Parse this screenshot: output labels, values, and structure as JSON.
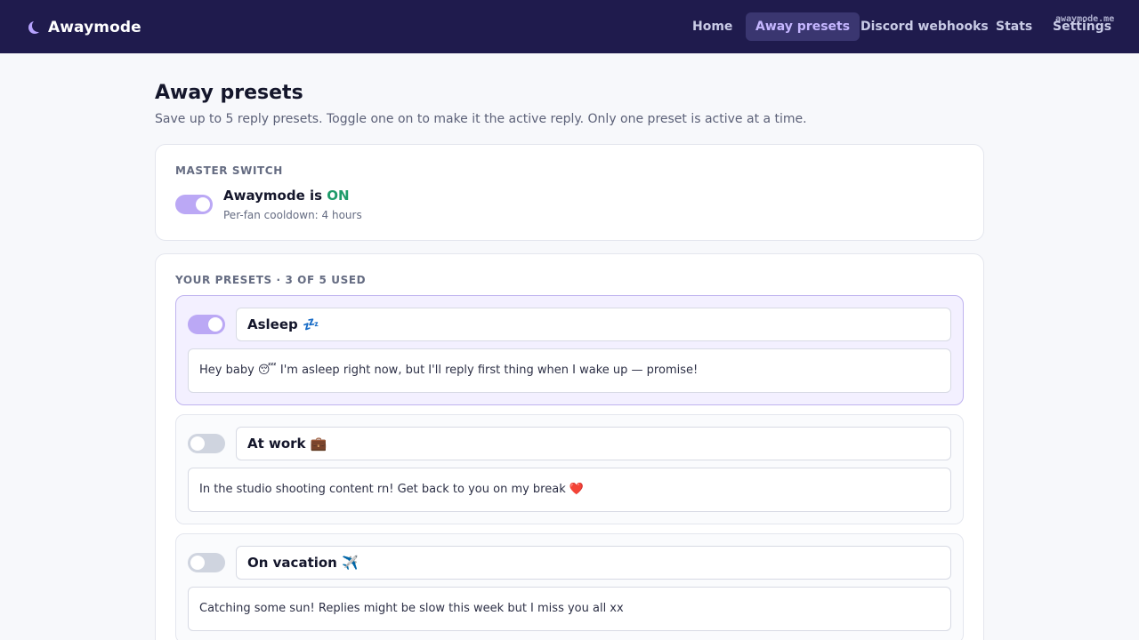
{
  "app": {
    "name": "Awaymode",
    "watermark": "awaymode.me"
  },
  "nav": {
    "items": [
      {
        "label": "Home",
        "active": false
      },
      {
        "label": "Away presets",
        "active": true
      },
      {
        "label": "Discord webhooks",
        "active": false
      },
      {
        "label": "Stats",
        "active": false
      },
      {
        "label": "Settings",
        "active": false
      }
    ]
  },
  "page": {
    "title": "Away presets",
    "subtitle": "Save up to 5 reply presets. Toggle one on to make it the active reply. Only one preset is active at a time."
  },
  "master": {
    "section_label": "MASTER SWITCH",
    "enabled": true,
    "title_prefix": "Awaymode is",
    "status": "ON",
    "cooldown": "Per-fan cooldown: 4 hours"
  },
  "presets": {
    "section_label": "YOUR PRESETS · 3 OF 5 USED",
    "items": [
      {
        "name": "Asleep 💤",
        "message": "Hey baby 😴 I'm asleep right now, but I'll reply first thing when I wake up — promise!",
        "active": true
      },
      {
        "name": "At work 💼",
        "message": "In the studio shooting content rn! Get back to you on my break ❤️",
        "active": false
      },
      {
        "name": "On vacation ✈️",
        "message": "Catching some sun! Replies might be slow this week but I miss you all xx",
        "active": false
      }
    ]
  },
  "colors": {
    "nav_bg": "#1f1b4d",
    "accent": "#bba8f5",
    "status_on": "#1f9b6a"
  }
}
